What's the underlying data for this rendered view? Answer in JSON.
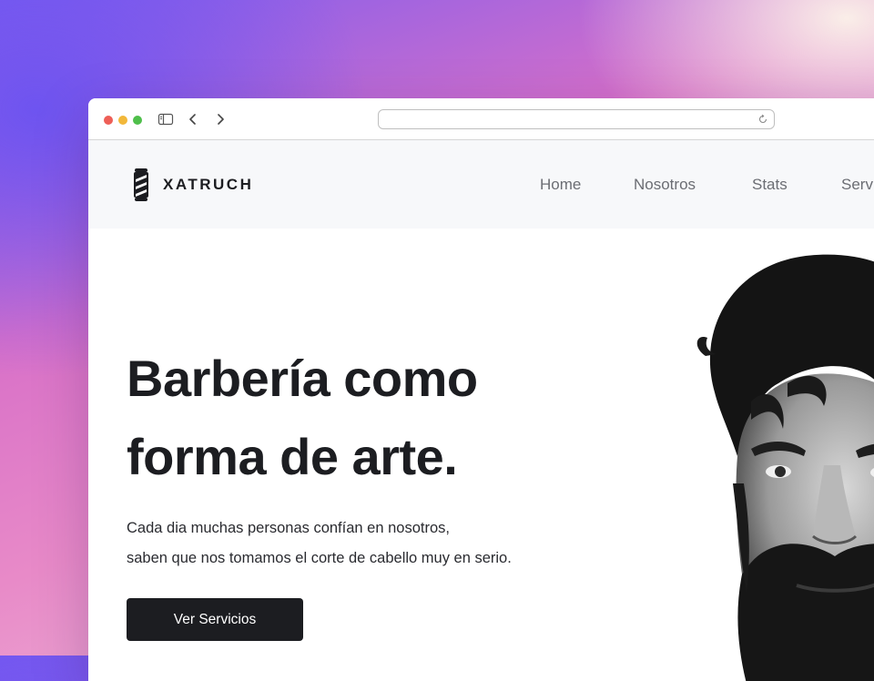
{
  "browser": {
    "address_value": ""
  },
  "site": {
    "brand": "XATRUCH",
    "nav": [
      {
        "label": "Home"
      },
      {
        "label": "Nosotros"
      },
      {
        "label": "Stats"
      },
      {
        "label": "Serv"
      }
    ]
  },
  "hero": {
    "headline_line1": "Barbería como",
    "headline_line2": "forma de arte.",
    "sub_line1": "Cada dia muchas personas confían en nosotros,",
    "sub_line2": "saben que nos tomamos el corte de cabello muy en serio.",
    "cta_label": "Ver Servicios"
  },
  "icons": {
    "logo": "barber-pole-icon",
    "sidebar": "sidebar-toggle-icon",
    "back": "chevron-left-icon",
    "forward": "chevron-right-icon",
    "reload": "reload-icon"
  },
  "colors": {
    "brand_dark": "#1c1d21",
    "nav_bg": "#f7f8fa",
    "nav_text": "#6b6d73",
    "close": "#ee5f57",
    "minimize": "#f2b83a",
    "maximize": "#4fbf4b"
  }
}
